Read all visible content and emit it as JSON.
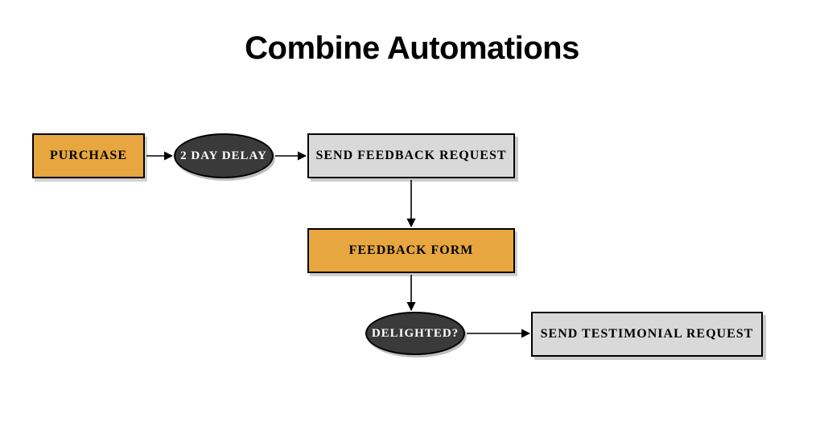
{
  "title": "Combine Automations",
  "nodes": {
    "purchase": {
      "label": "PURCHASE",
      "type": "rect-orange"
    },
    "delay": {
      "label": "2 DAY DELAY",
      "type": "ellipse"
    },
    "sendFeed": {
      "label": "SEND FEEDBACK REQUEST",
      "type": "rect-gray"
    },
    "feedForm": {
      "label": "FEEDBACK FORM",
      "type": "rect-orange"
    },
    "delighted": {
      "label": "DELIGHTED?",
      "type": "ellipse"
    },
    "sendTest": {
      "label": "SEND TESTIMONIAL REQUEST",
      "type": "rect-gray"
    }
  },
  "edges": [
    {
      "from": "purchase",
      "to": "delay"
    },
    {
      "from": "delay",
      "to": "sendFeed"
    },
    {
      "from": "sendFeed",
      "to": "feedForm"
    },
    {
      "from": "feedForm",
      "to": "delighted"
    },
    {
      "from": "delighted",
      "to": "sendTest"
    }
  ],
  "colors": {
    "orange": "#e7a63f",
    "gray": "#d9d9d9",
    "dark": "#3a3a3a",
    "stroke": "#000000"
  }
}
